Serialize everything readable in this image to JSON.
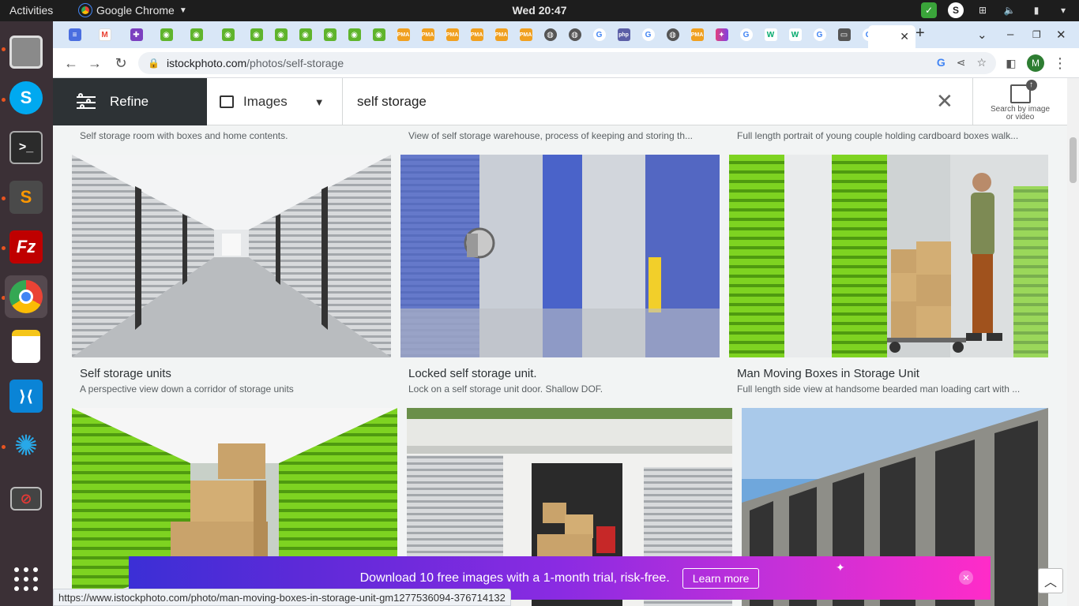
{
  "topbar": {
    "activities": "Activities",
    "app_name": "Google Chrome",
    "clock": "Wed 20:47"
  },
  "browser": {
    "url_domain": "istockphoto.com",
    "url_path": "/photos/self-storage",
    "profile_initial": "M",
    "hover_url": "https://www.istockphoto.com/photo/man-moving-boxes-in-storage-unit-gm1277536094-376714132"
  },
  "search": {
    "refine_label": "Refine",
    "type_label": "Images",
    "query": "self storage",
    "by_image_line1": "Search by image",
    "by_image_line2": "or video"
  },
  "results_top": [
    {
      "desc": "Self storage room with boxes and home contents."
    },
    {
      "desc": "View of self storage warehouse, process of keeping and storing th..."
    },
    {
      "desc": "Full length portrait of young couple holding cardboard boxes walk..."
    }
  ],
  "results": [
    {
      "title": "Self storage units",
      "desc": "A perspective view down a corridor of storage units"
    },
    {
      "title": "Locked self storage unit.",
      "desc": "Lock on a self storage unit door. Shallow DOF."
    },
    {
      "title": "Man Moving Boxes in Storage Unit",
      "desc": "Full length side view at handsome bearded man loading cart with ..."
    }
  ],
  "promo": {
    "text": "Download 10 free images with a 1-month trial, risk-free.",
    "button": "Learn more"
  },
  "colors": {
    "refine_bg": "#2d3235",
    "accent_green": "#7ed321",
    "promo_start": "#3b2fd6",
    "promo_end": "#ff2cc8"
  }
}
